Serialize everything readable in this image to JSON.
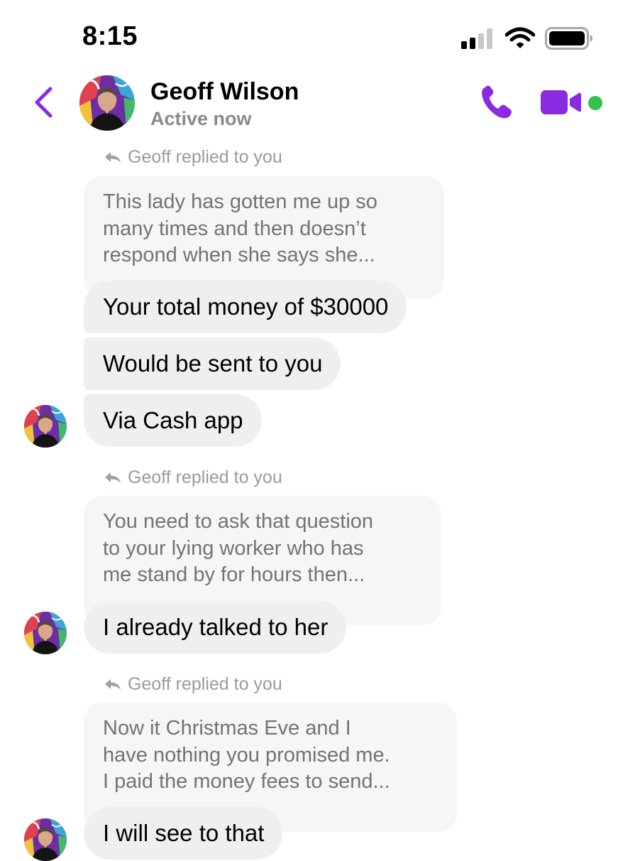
{
  "status_bar": {
    "time": "8:15"
  },
  "header": {
    "contact_name": "Geoff Wilson",
    "contact_status": "Active now",
    "accent_color": "#8a2be2",
    "online_color": "#31c24f",
    "icons": [
      "back-chevron-icon",
      "phone-icon",
      "video-camera-icon"
    ]
  },
  "conversation": {
    "groups": [
      {
        "reply_label": "Geoff replied to you",
        "quoted_text": [
          "This lady has gotten me up so",
          "many times and then doesn’t",
          "respond when she says she..."
        ],
        "messages": [
          "Your total money of $30000",
          "Would be sent to you",
          "Via Cash app"
        ]
      },
      {
        "reply_label": "Geoff replied to you",
        "quoted_text": [
          "You need to ask that question",
          "to your lying worker who has",
          "me stand by for hours then..."
        ],
        "messages": [
          "I already talked to her"
        ]
      },
      {
        "reply_label": "Geoff replied to you",
        "quoted_text": [
          "Now it Christmas Eve and I",
          "have nothing you promised me.",
          "I paid the money fees to send..."
        ],
        "messages": [
          "I will see to that"
        ]
      }
    ]
  }
}
